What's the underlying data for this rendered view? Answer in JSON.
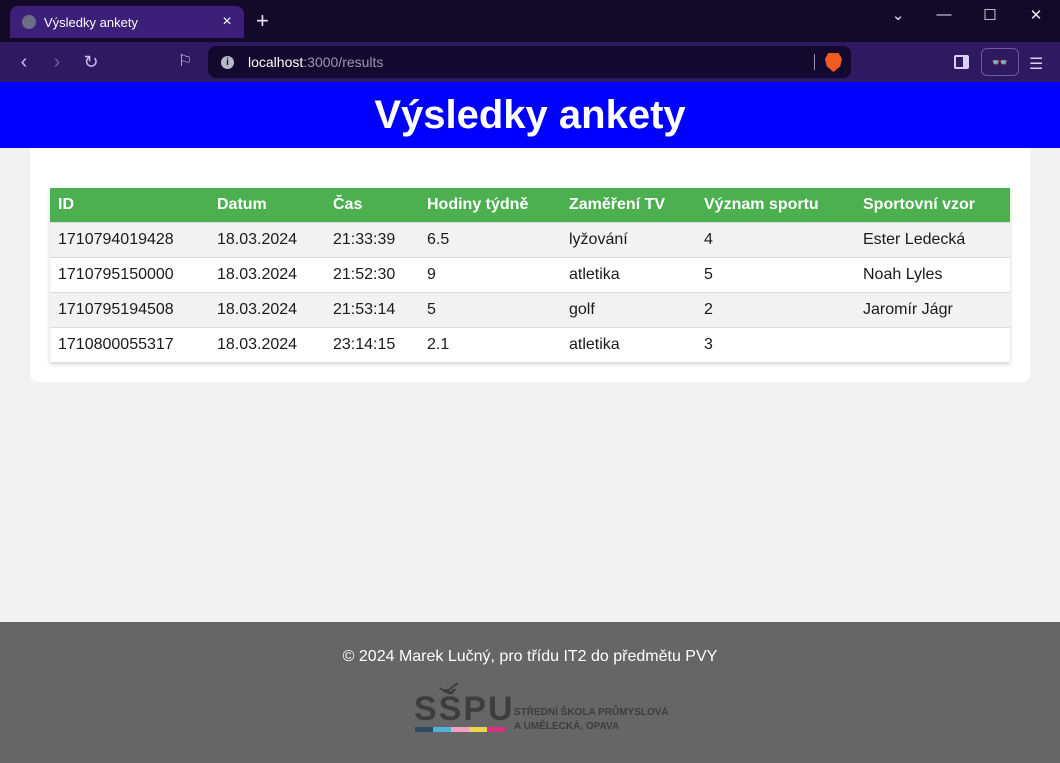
{
  "browser": {
    "tab_title": "Výsledky ankety",
    "new_tab": "+",
    "url_host": "localhost",
    "url_rest": ":3000/results",
    "controls": {
      "minimize": "—",
      "maximize": "☐",
      "close": "✕",
      "dropdown": "⌄"
    }
  },
  "page": {
    "title": "Výsledky ankety"
  },
  "table": {
    "headers": [
      "ID",
      "Datum",
      "Čas",
      "Hodiny týdně",
      "Zaměření TV",
      "Význam sportu",
      "Sportovní vzor"
    ],
    "rows": [
      [
        "1710794019428",
        "18.03.2024",
        "21:33:39",
        "6.5",
        "lyžování",
        "4",
        "Ester Ledecká"
      ],
      [
        "1710795150000",
        "18.03.2024",
        "21:52:30",
        "9",
        "atletika",
        "5",
        "Noah Lyles"
      ],
      [
        "1710795194508",
        "18.03.2024",
        "21:53:14",
        "5",
        "golf",
        "2",
        "Jaromír Jágr"
      ],
      [
        "1710800055317",
        "18.03.2024",
        "23:14:15",
        "2.1",
        "atletika",
        "3",
        ""
      ]
    ]
  },
  "footer": {
    "text": "© 2024 Marek Lučný, pro třídu IT2 do předmětu PVY",
    "logo": {
      "word": "SŠPU",
      "line1": "STŘEDNÍ ŠKOLA PRŮMYSLOVÁ",
      "line2": "A UMĚLECKÁ, OPAVA",
      "bar_colors": [
        "#2c4a5e",
        "#4fb3d9",
        "#f2a1c0",
        "#e8d84a",
        "#d63384"
      ]
    }
  },
  "colors": {
    "header_bg": "#0000ff",
    "table_header_bg": "#4caf50",
    "footer_bg": "#666666"
  }
}
